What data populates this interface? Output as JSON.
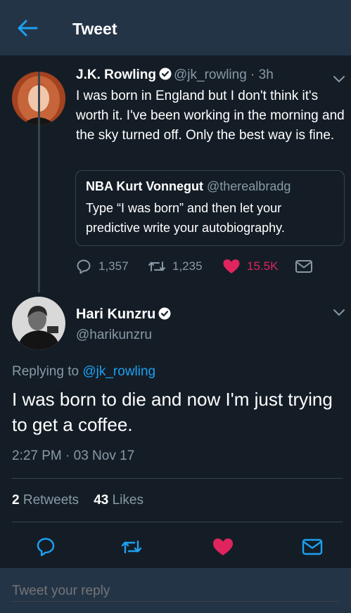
{
  "header": {
    "title": "Tweet",
    "back_icon": "arrow-left-icon"
  },
  "parent_tweet": {
    "name": "J.K. Rowling",
    "handle_time": "@jk_rowling · 3h",
    "text": "I was born in England but I don't think it's worth it. I've been working in the morning and the sky turned off. Only the best way is fine.",
    "quote": {
      "name": "NBA Kurt Vonnegut",
      "handle": "@therealbradg",
      "text": "Type “I was born” and then let your predictive write your autobiography."
    },
    "actions": {
      "replies": "1,357",
      "retweets": "1,235",
      "likes": "15.5K"
    }
  },
  "main_tweet": {
    "name": "Hari Kunzru",
    "handle": "@harikunzru",
    "replying_prefix": "Replying to",
    "replying_to": "@jk_rowling",
    "text": "I was born to die and now I'm just trying to get a coffee.",
    "timestamp": "2:27 PM · 03 Nov 17",
    "retweet_count": "2",
    "retweet_label": "Retweets",
    "like_count": "43",
    "like_label": "Likes"
  },
  "reply": {
    "placeholder": "Tweet your reply"
  },
  "colors": {
    "background": "#141d26",
    "header": "#243447",
    "accent_blue": "#1da1f2",
    "like_red": "#e0245e",
    "muted": "#8899a6"
  }
}
